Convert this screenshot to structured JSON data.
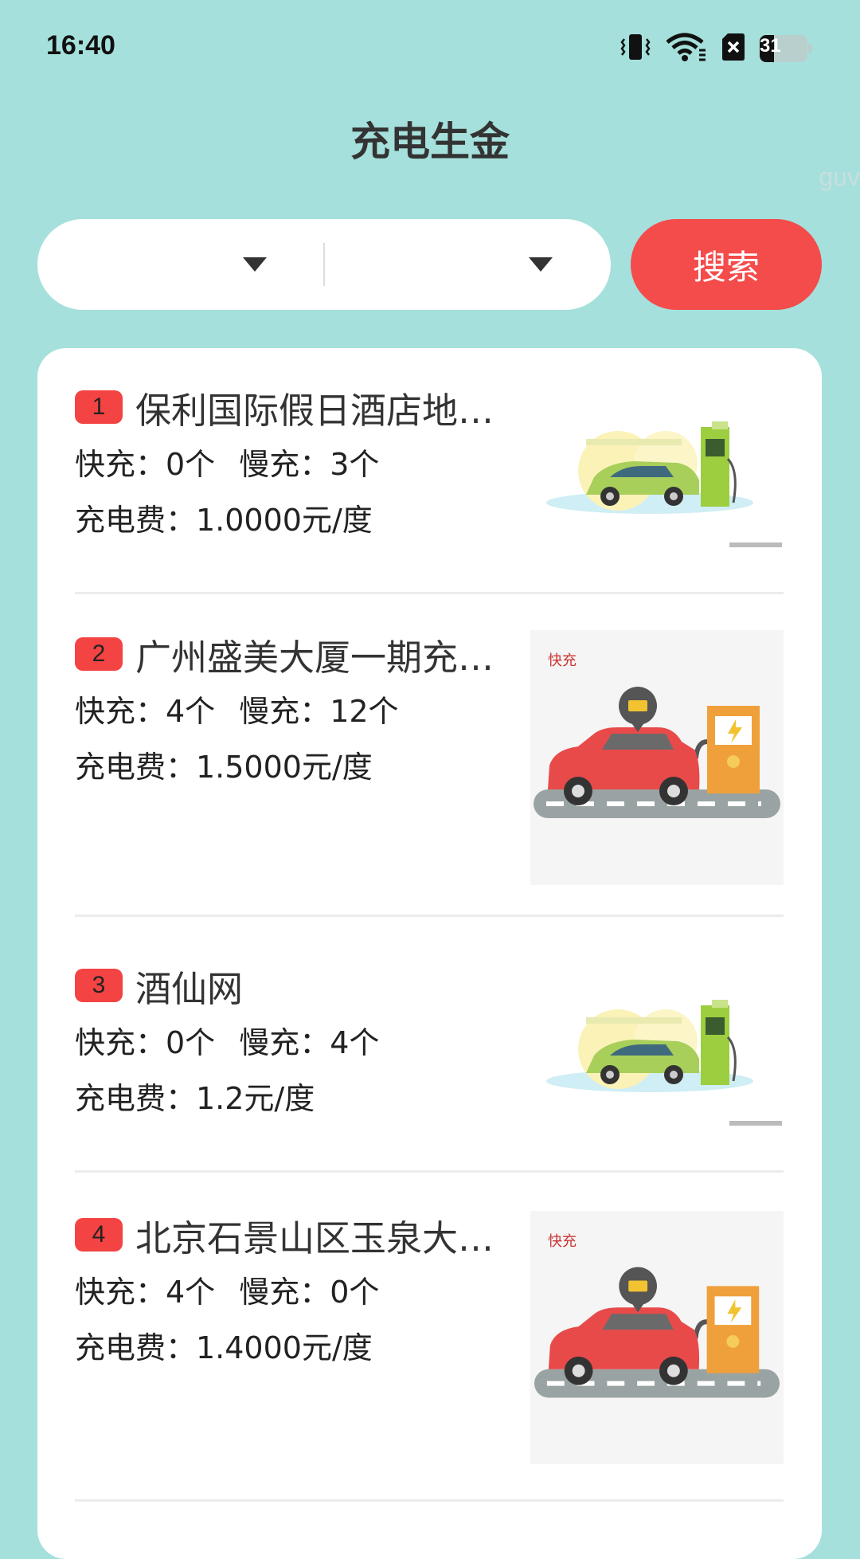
{
  "status": {
    "time": "16:40",
    "battery": "31",
    "icons": [
      "vibrate-icon",
      "wifi-icon",
      "sim-off-icon",
      "battery-icon"
    ]
  },
  "header": {
    "title": "充电生金",
    "watermark": "guv"
  },
  "filters": {
    "select1_value": "",
    "select2_value": "",
    "search_label": "搜索"
  },
  "colors": {
    "background": "#a5e0dc",
    "accent": "#f44b4b",
    "rank_badge": "#f44343"
  },
  "stations": [
    {
      "rank": "1",
      "name": "保利国际假日酒店地…",
      "fast": "快充：0个",
      "slow": "慢充：3个",
      "fee": "充电费：1.0000元/度",
      "image": "green-car-charging-illustration",
      "image_label": ""
    },
    {
      "rank": "2",
      "name": "广州盛美大厦一期充…",
      "fast": "快充：4个",
      "slow": "慢充：12个",
      "fee": "充电费：1.5000元/度",
      "image": "red-car-charging-illustration",
      "image_label": "快充"
    },
    {
      "rank": "3",
      "name": "酒仙网",
      "fast": "快充：0个",
      "slow": "慢充：4个",
      "fee": "充电费：1.2元/度",
      "image": "green-car-charging-illustration",
      "image_label": ""
    },
    {
      "rank": "4",
      "name": "北京石景山区玉泉大…",
      "fast": "快充：4个",
      "slow": "慢充：0个",
      "fee": "充电费：1.4000元/度",
      "image": "red-car-charging-illustration",
      "image_label": "快充"
    }
  ]
}
